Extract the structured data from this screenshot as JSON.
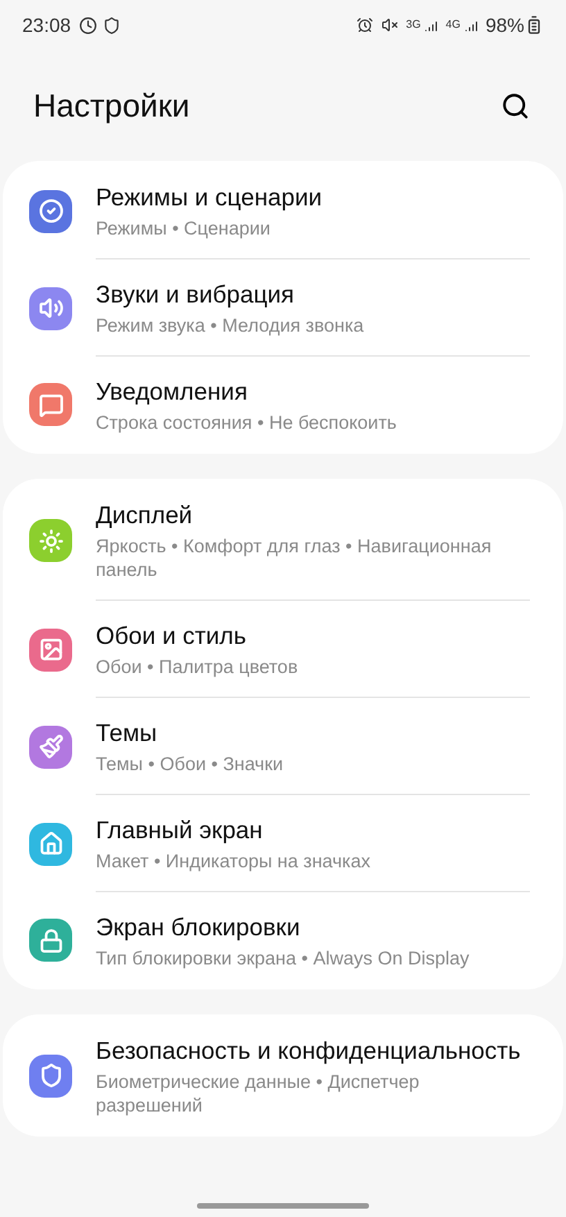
{
  "status_bar": {
    "time": "23:08",
    "network_3g": "3G",
    "network_4g": "4G",
    "battery": "98%"
  },
  "header": {
    "title": "Настройки"
  },
  "groups": [
    {
      "items": [
        {
          "kind": "modes",
          "color": "#5a74e0",
          "title": "Режимы и сценарии",
          "subtitle": "Режимы • Сценарии"
        },
        {
          "kind": "sound",
          "color": "#8c87f0",
          "title": "Звуки и вибрация",
          "subtitle": "Режим звука • Мелодия звонка"
        },
        {
          "kind": "notifications",
          "color": "#f0786a",
          "title": "Уведомления",
          "subtitle": "Строка состояния • Не беспокоить"
        }
      ]
    },
    {
      "items": [
        {
          "kind": "display",
          "color": "#8ccf2e",
          "title": "Дисплей",
          "subtitle": "Яркость • Комфорт для глаз • Навигационная панель"
        },
        {
          "kind": "wallpaper",
          "color": "#ea6a8c",
          "title": "Обои и стиль",
          "subtitle": "Обои • Палитра цветов"
        },
        {
          "kind": "themes",
          "color": "#b278e0",
          "title": "Темы",
          "subtitle": "Темы • Обои • Значки"
        },
        {
          "kind": "home",
          "color": "#2fb8e0",
          "title": "Главный экран",
          "subtitle": "Макет • Индикаторы на значках"
        },
        {
          "kind": "lock",
          "color": "#2eb09a",
          "title": "Экран блокировки",
          "subtitle": "Тип блокировки экрана • Always On Display"
        }
      ]
    },
    {
      "items": [
        {
          "kind": "security",
          "color": "#6f7ff0",
          "title": "Безопасность и конфиденциальность",
          "subtitle": "Биометрические данные • Диспетчер разрешений"
        }
      ]
    }
  ]
}
